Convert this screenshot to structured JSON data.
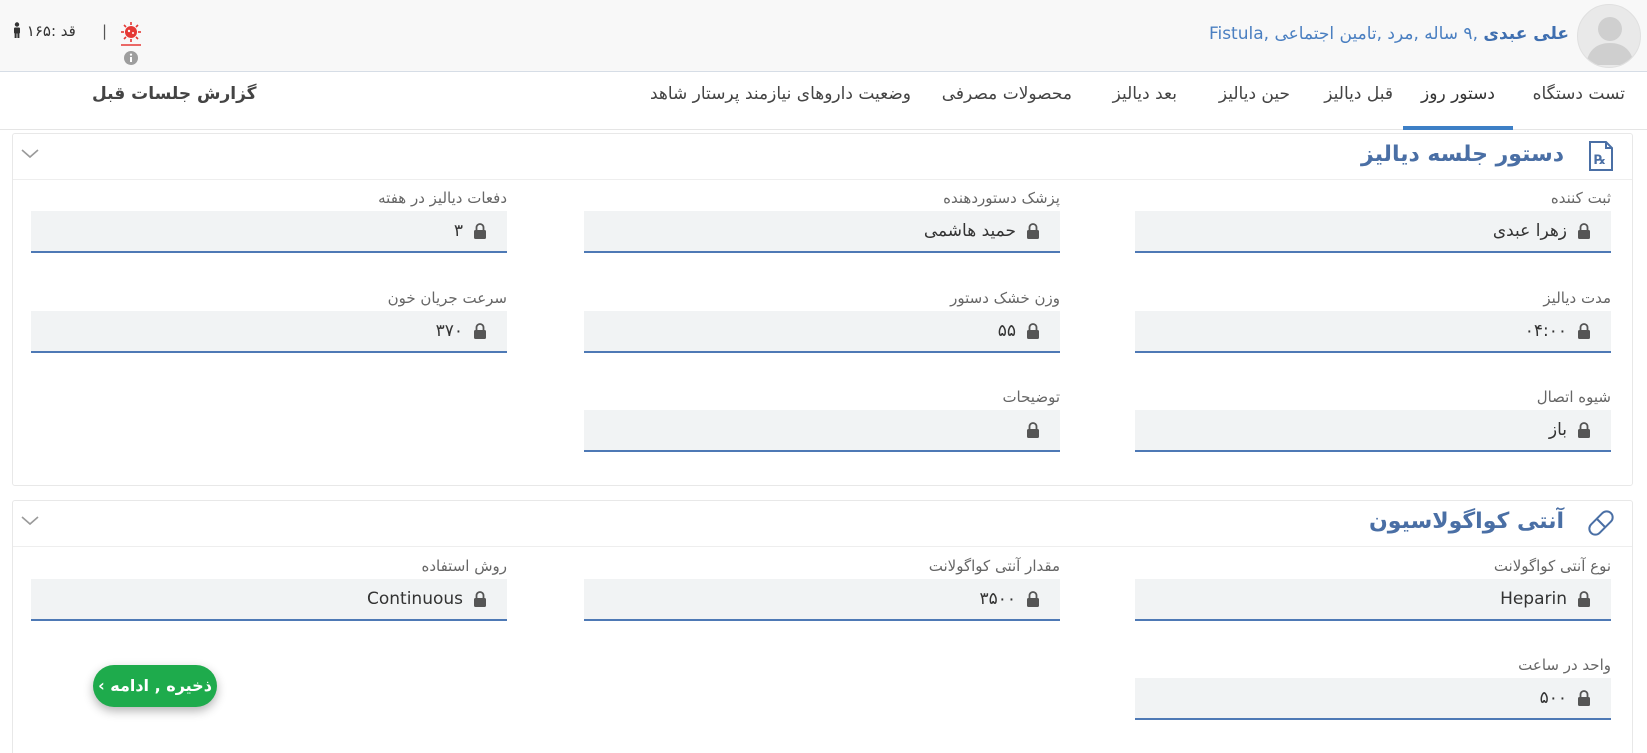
{
  "header": {
    "patient_name": "علی عبدی",
    "patient_details": " ,۹ ساله ,مرد ,تامین اجتماعی ,Fistula",
    "height_text": "قد :۱۶۵",
    "separator": "|"
  },
  "tabs": [
    {
      "label": "تست دستگاه"
    },
    {
      "label": "دستور روز"
    },
    {
      "label": "قبل دیالیز"
    },
    {
      "label": "حین دیالیز"
    },
    {
      "label": "بعد دیالیز"
    },
    {
      "label": "محصولات مصرفی"
    },
    {
      "label": "وضعیت داروهای نیازمند پرستار شاهد"
    }
  ],
  "active_tab": "دستور روز",
  "report_tab": "گزارش جلسات قبل",
  "panels": {
    "dialysis": {
      "title": "دستور جلسه دیالیز",
      "fields": {
        "registrar": {
          "label": "ثبت کننده",
          "value": "زهرا عبدی"
        },
        "doctor": {
          "label": "پزشک دستوردهنده",
          "value": "حمید هاشمی"
        },
        "sessions": {
          "label": "دفعات دیالیز در هفته",
          "value": "۳"
        },
        "duration": {
          "label": "مدت دیالیز",
          "value": "۰۴:۰۰"
        },
        "dry_weight": {
          "label": "وزن خشک دستور",
          "value": "۵۵"
        },
        "blood_flow": {
          "label": "سرعت جریان خون",
          "value": "۳۷۰"
        },
        "connection": {
          "label": "شیوه اتصال",
          "value": "باز"
        },
        "notes": {
          "label": "توضیحات",
          "value": ""
        }
      }
    },
    "anticoag": {
      "title": "آنتی کواگولاسیون",
      "fields": {
        "type": {
          "label": "نوع آنتی کواگولانت",
          "value": "Heparin"
        },
        "amount": {
          "label": "مقدار آنتی کواگولانت",
          "value": "۳۵۰۰"
        },
        "method": {
          "label": "روش استفاده",
          "value": "Continuous"
        },
        "unit_per_hour": {
          "label": "واحد در ساعت",
          "value": "۵۰۰"
        }
      }
    }
  },
  "save_button": "ذخیره , ادامه ›",
  "colors": {
    "accent": "#3d7fc6",
    "title": "#4a6fa5",
    "save": "#1eab4c",
    "virus": "#e53935"
  }
}
